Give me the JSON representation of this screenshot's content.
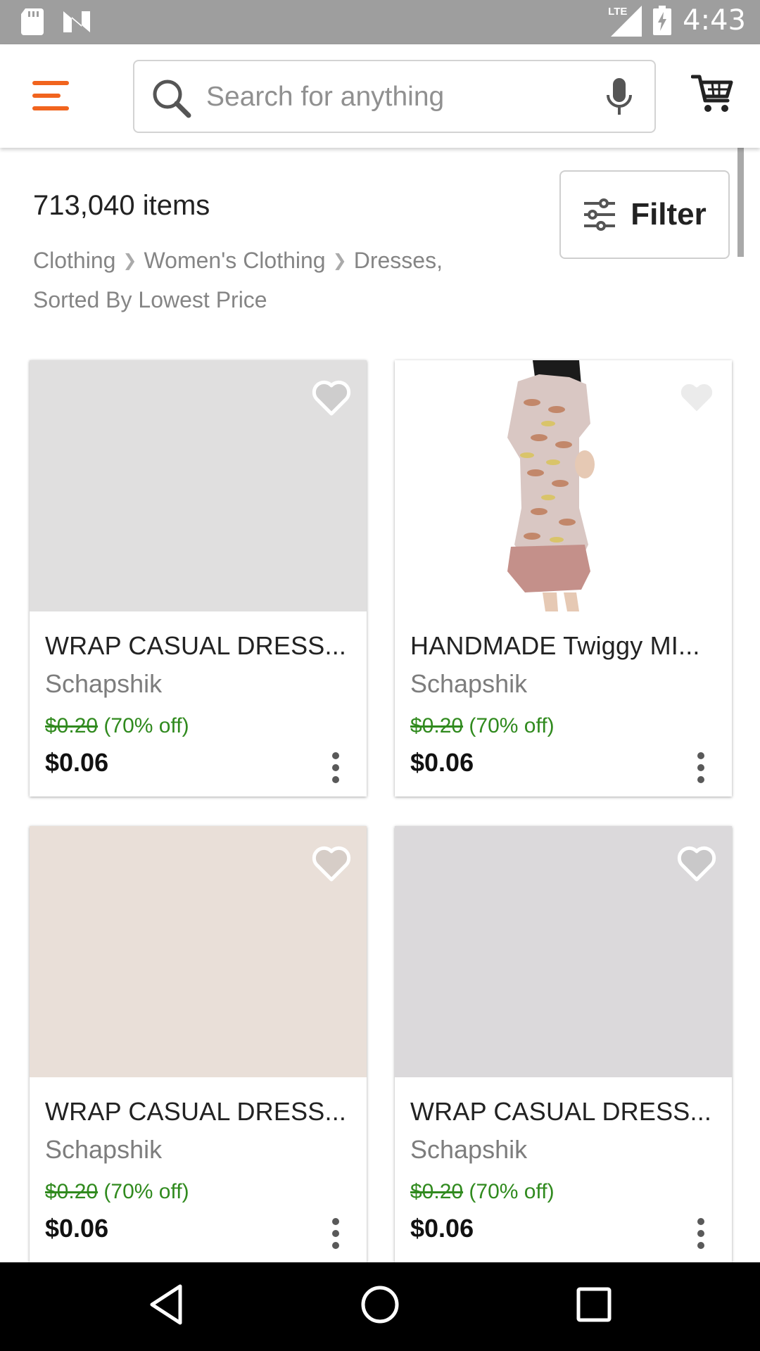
{
  "status_bar": {
    "time": "4:43",
    "network": "LTE",
    "icons": [
      "sd-card-icon",
      "n-notification-icon",
      "signal-icon",
      "battery-charging-icon"
    ]
  },
  "header": {
    "search": {
      "placeholder": "Search for anything",
      "value": ""
    },
    "icons": [
      "menu-icon",
      "search-icon",
      "mic-icon",
      "cart-icon"
    ],
    "accent_color": "#f1641e"
  },
  "results": {
    "count": "713,040 items",
    "breadcrumb": [
      "Clothing",
      "Women's Clothing",
      "Dresses,"
    ],
    "sort": "Sorted By Lowest Price",
    "filter_label": "Filter"
  },
  "products": [
    {
      "title": "WRAP CASUAL DRESS...",
      "shop": "Schapshik",
      "original_price": "$0.20",
      "discount": "(70% off)",
      "price": "$0.06",
      "image_color": "#e0dfdf"
    },
    {
      "title": "HANDMADE Twiggy MI...",
      "shop": "Schapshik",
      "original_price": "$0.20",
      "discount": "(70% off)",
      "price": "$0.06",
      "image_color": "#ffffff"
    },
    {
      "title": "WRAP CASUAL DRESS...",
      "shop": "Schapshik",
      "original_price": "$0.20",
      "discount": "(70% off)",
      "price": "$0.06",
      "image_color": "#e9dfd8"
    },
    {
      "title": "WRAP CASUAL DRESS...",
      "shop": "Schapshik",
      "original_price": "$0.20",
      "discount": "(70% off)",
      "price": "$0.06",
      "image_color": "#dbd9db"
    }
  ],
  "colors": {
    "discount_green": "#308a1e",
    "statusbar": "#9e9e9e"
  },
  "nav_bar": {
    "icons": [
      "back-icon",
      "home-icon",
      "recents-icon"
    ]
  }
}
